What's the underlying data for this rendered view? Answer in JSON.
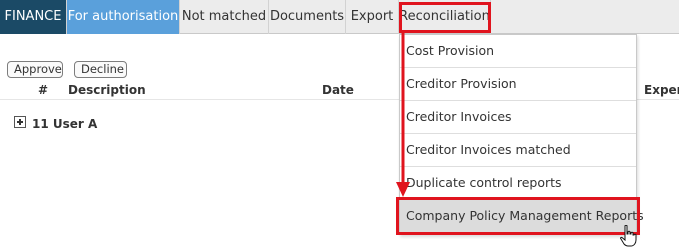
{
  "tabs": [
    {
      "label": "FINANCE"
    },
    {
      "label": "For authorisation"
    },
    {
      "label": "Not matched"
    },
    {
      "label": "Documents"
    },
    {
      "label": "Export"
    },
    {
      "label": "Reconciliation"
    }
  ],
  "actions": {
    "approve": "Approve",
    "decline": "Decline"
  },
  "table": {
    "headers": [
      "#",
      "Description",
      "Date",
      "Exper"
    ],
    "group": "11 User A"
  },
  "menu": {
    "items": [
      {
        "label": "Cost Provision"
      },
      {
        "label": "Creditor Provision"
      },
      {
        "label": "Creditor Invoices"
      },
      {
        "label": "Creditor Invoices matched"
      },
      {
        "label": "Duplicate control reports"
      },
      {
        "label": "Company Policy Management Reports"
      }
    ]
  },
  "colors": {
    "brand_tab": "#1b4a66",
    "active_tab": "#5aa0db",
    "highlight": "#e0141e"
  },
  "icons": [
    "expand-plus-icon",
    "hand-pointer-icon",
    "down-arrow-icon"
  ]
}
